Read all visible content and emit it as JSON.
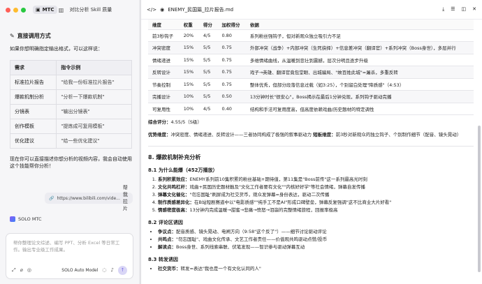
{
  "left": {
    "app_name": "MTC",
    "title": "对比分析 Skill 质量",
    "section_title": "直接调用方式",
    "intro": "如果你想明确指定输出格式，可以这样说：",
    "table": {
      "headers": [
        "需求",
        "指令示例"
      ],
      "rows": [
        [
          "标准拉片报告",
          "\"给我一份标准拉片报告\""
        ],
        [
          "爆款机制分析",
          "\"分析一下爆款机制\""
        ],
        [
          "分镜表",
          "\"输出分镜表\""
        ],
        [
          "创作模板",
          "\"提炼成可复用模板\""
        ],
        [
          "优化建议",
          "\"给一些优化建议\""
        ]
      ]
    },
    "ask": "现在你可以直接描述你想分析的视频内容，我会自动使用这个技能帮你分析！",
    "bubble_url": "https://www.bilibili.com/vide...",
    "bubble_label": "帮我拉片",
    "agent_name": "SOLO MTC",
    "composer_placeholder": "帮你整理论文综述、编写 PPT、分析 Excel 等日常工作。输出专业级工作成果。",
    "model_label": "SOLO Auto Model"
  },
  "right": {
    "file_name": "ENEMY_民国篇_拉片报告.md",
    "score_table": {
      "headers": [
        "维度",
        "权重",
        "得分",
        "加权得分",
        "依据"
      ],
      "rows": [
        [
          "前3秒钩子",
          "20%",
          "4/5",
          "0.80",
          "系列粉丝强钩子，但对新观众独立吸引力不足"
        ],
        [
          "冲突密度",
          "15%",
          "5/5",
          "0.75",
          "外部冲突（战争）+内部冲突（生死抉择）+信息差冲突（翻译官）+系列冲突（Boss身世），多层并行"
        ],
        [
          "情绪递进",
          "15%",
          "5/5",
          "0.75",
          "多维情绪曲线，从温暖到悲壮到震撼，层次分明且逐步升级"
        ],
        [
          "反转设计",
          "15%",
          "5/5",
          "0.75",
          "戏子→英雄、翻译官竟包堂眼、出城骗局、\"故百姓此城\"=屠杀，多重反转"
        ],
        [
          "节奏控制",
          "15%",
          "5/5",
          "0.75",
          "整体优秀，但部分段落信息过载（如3:25），个别留白处理\"降质感\"（4:53）"
        ],
        [
          "完播设计",
          "10%",
          "5/5",
          "0.50",
          "13分钟时长\"很安心\"，Boss揭示在最后1分钟兑现，系列钩子驱动完播"
        ],
        [
          "可复用性",
          "10%",
          "4/5",
          "0.40",
          "结构和手法可复用度高，但高度依赖戏曲/历史题材的特定调性"
        ]
      ]
    },
    "total_label": "综合评分：",
    "total_value": "4.55/5（S级）",
    "summary_label1": "优势维度：",
    "summary_text1": "冲突密度、情绪递进、反转设计——三者协同构成了极强的叙事驱动力 ",
    "summary_label2": "短板维度：",
    "summary_text2": "前3秒对新观众的独立钩子、个别制作细节（配音、镜头晃动）",
    "h2": "8. 爆款机制补充分析",
    "h3a": "8.1 为什么能爆（452万播放）",
    "list_a": [
      [
        "系列积累效应：",
        "ENEMY系列前10集积累的粉丝基础+期待值，第11集是\"Boss前传\"这一系列最高光时刻"
      ],
      [
        "文化共鸣杠杆：",
        "戏曲+民国历史题材触及\"文化工作者要有文化\"\"内核好好学\"等社会情绪，弹幕自发传播"
      ],
      [
        "弹幕文化催化：",
        "\"勿忘国耻\"刷屏成为社交货币，观众发弹幕=身份表达，驱动二次传播"
      ],
      [
        "制作质感差异化：",
        "在B站短剧赛道中以\"电影质感\"\"纯手工不是AI\"形成口碑壁垒，弹幕反复强调\"这不比商业大片好看\""
      ],
      [
        "情感密度极高：",
        "13分钟内完成温暖→甜蜜→悲痛→愤怒→泪崩的完整情绪旅程，回报率极高"
      ]
    ],
    "h3b": "8.2 评论区诱因",
    "list_b": [
      [
        "争议点：",
        "配音质感、镜头晃动、电闸方向（9:58\"这个反了\"）——细节讨论驱动评论"
      ],
      [
        "共鸣点：",
        "\"勿忘国耻\"、戏曲文化传承、文艺工作者责任——价值观共鸣驱动点赞/投币"
      ],
      [
        "解读点：",
        "Boss身世、系列线索串联、伏笔发现——智识参与驱动弹幕互动"
      ]
    ],
    "h3c": "8.3 转发诱因",
    "list_c": [
      [
        "社交货币：",
        "转发=表达\"我也是一个有文化认同的人\""
      ]
    ]
  }
}
